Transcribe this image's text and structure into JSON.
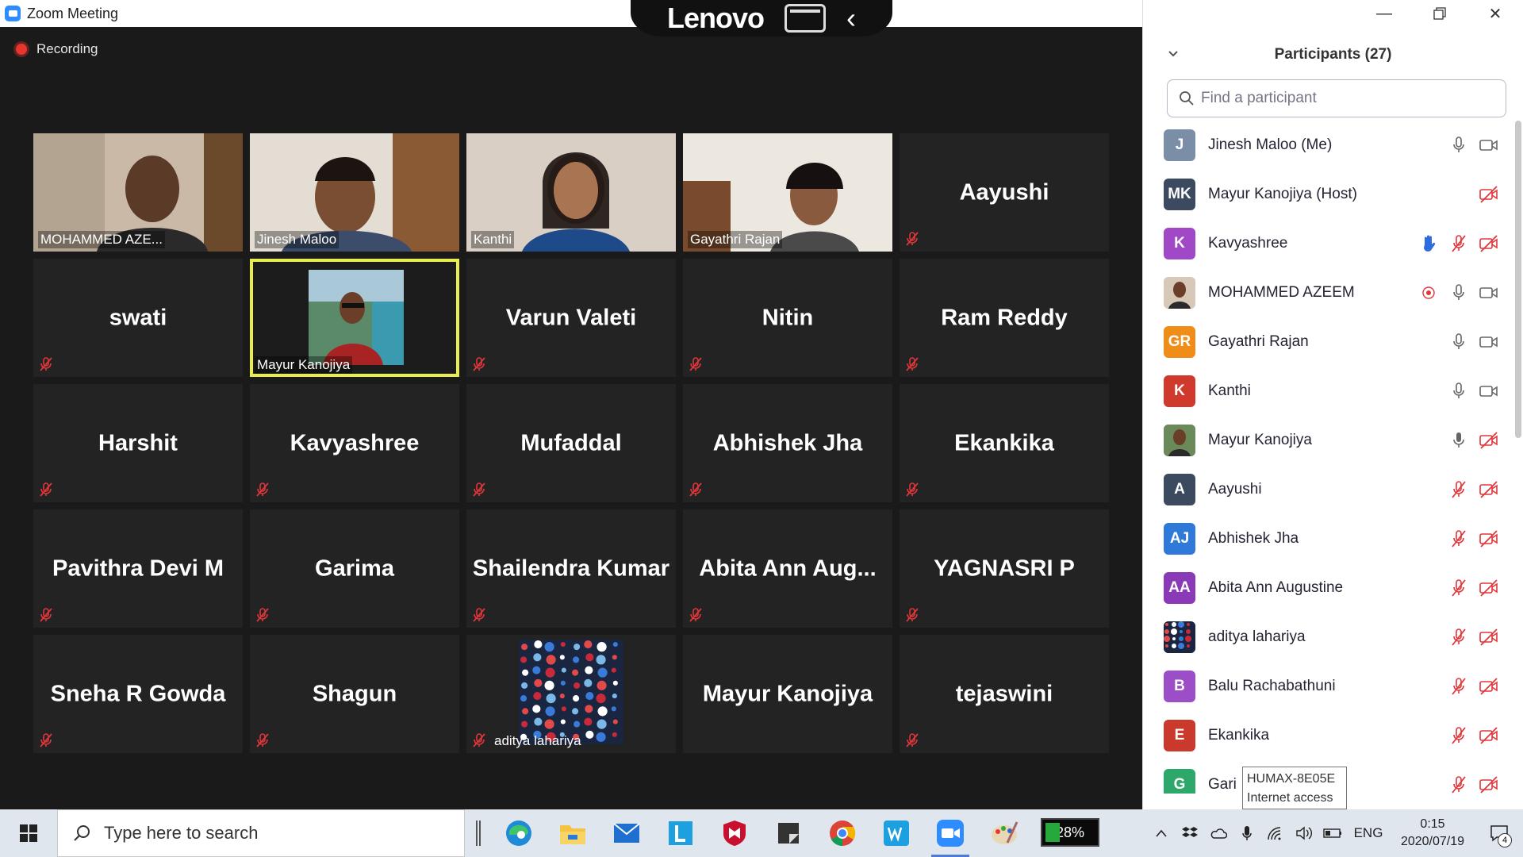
{
  "window": {
    "title": "Zoom Meeting"
  },
  "lenovo": {
    "brand": "Lenovo"
  },
  "recording": {
    "label": "Recording"
  },
  "tiles": [
    {
      "name": "MOHAMMED AZE...",
      "type": "video"
    },
    {
      "name": "Jinesh Maloo",
      "type": "video"
    },
    {
      "name": "Kanthi",
      "type": "video"
    },
    {
      "name": "Gayathri Rajan",
      "type": "video"
    },
    {
      "name": "Aayushi",
      "type": "name",
      "muted": true
    },
    {
      "name": "swati",
      "type": "name",
      "muted": true
    },
    {
      "name": "Mayur Kanojiya",
      "type": "photo",
      "active": true
    },
    {
      "name": "Varun Valeti",
      "type": "name",
      "muted": true
    },
    {
      "name": "Nitin",
      "type": "name",
      "muted": true
    },
    {
      "name": "Ram Reddy",
      "type": "name",
      "muted": true
    },
    {
      "name": "Harshit",
      "type": "name",
      "muted": true
    },
    {
      "name": "Kavyashree",
      "type": "name",
      "muted": true
    },
    {
      "name": "Mufaddal",
      "type": "name",
      "muted": true
    },
    {
      "name": "Abhishek Jha",
      "type": "name",
      "muted": true
    },
    {
      "name": "Ekankika",
      "type": "name",
      "muted": true
    },
    {
      "name": "Pavithra Devi M",
      "type": "name",
      "muted": true
    },
    {
      "name": "Garima",
      "type": "name",
      "muted": true
    },
    {
      "name": "Shailendra Kumar",
      "type": "name",
      "muted": true
    },
    {
      "name": "Abita Ann Aug...",
      "type": "name",
      "muted": true
    },
    {
      "name": "YAGNASRI P",
      "type": "name",
      "muted": true
    },
    {
      "name": "Sneha R Gowda",
      "type": "name",
      "muted": true
    },
    {
      "name": "Shagun",
      "type": "name",
      "muted": true
    },
    {
      "name": "aditya lahariya",
      "type": "pattern",
      "muted": true
    },
    {
      "name": "Mayur Kanojiya",
      "type": "name",
      "muted": false
    },
    {
      "name": "tejaswini",
      "type": "name",
      "muted": true
    }
  ],
  "panel": {
    "title": "Participants (27)",
    "search_placeholder": "Find a participant",
    "participants": [
      {
        "initials": "J",
        "color": "#7b8ea8",
        "name": "Jinesh Maloo (Me)",
        "mic": "on",
        "video": "on"
      },
      {
        "initials": "MK",
        "color": "#3c4a5f",
        "name": "Mayur Kanojiya (Host)",
        "mic": "none",
        "video": "off"
      },
      {
        "initials": "K",
        "color": "#a048c6",
        "name": "Kavyashree",
        "hand": true,
        "mic": "muted",
        "video": "off"
      },
      {
        "initials": "",
        "color": "#d8c8b8",
        "name": "MOHAMMED AZEEM",
        "record": true,
        "mic": "on",
        "video": "on",
        "avatar": "photo"
      },
      {
        "initials": "GR",
        "color": "#f08c18",
        "name": "Gayathri Rajan",
        "mic": "on",
        "video": "on"
      },
      {
        "initials": "K",
        "color": "#d03a2c",
        "name": "Kanthi",
        "mic": "on",
        "video": "on"
      },
      {
        "initials": "",
        "color": "#6a8a5a",
        "name": "Mayur Kanojiya",
        "mic": "on-filled",
        "video": "off",
        "avatar": "photo"
      },
      {
        "initials": "A",
        "color": "#3c4a5f",
        "name": "Aayushi",
        "mic": "muted",
        "video": "off"
      },
      {
        "initials": "AJ",
        "color": "#2f7ad8",
        "name": "Abhishek Jha",
        "mic": "muted",
        "video": "off"
      },
      {
        "initials": "AA",
        "color": "#8a3ab6",
        "name": "Abita Ann Augustine",
        "mic": "muted",
        "video": "off"
      },
      {
        "initials": "",
        "color": "#243a6a",
        "name": "aditya lahariya",
        "mic": "muted",
        "video": "off",
        "avatar": "pattern"
      },
      {
        "initials": "B",
        "color": "#9b4ec8",
        "name": "Balu Rachabathuni",
        "mic": "muted",
        "video": "off"
      },
      {
        "initials": "E",
        "color": "#c93a2c",
        "name": "Ekankika",
        "mic": "muted",
        "video": "off"
      },
      {
        "initials": "G",
        "color": "#2ea86a",
        "name": "Gari",
        "mic": "muted",
        "video": "off"
      }
    ]
  },
  "tooltip": {
    "line1": "HUMAX-8E05E",
    "line2": "Internet access"
  },
  "taskbar": {
    "search_placeholder": "Type here to search",
    "battery": "28%",
    "language": "ENG",
    "time": "0:15",
    "date": "2020/07/19",
    "notifications": "4"
  }
}
